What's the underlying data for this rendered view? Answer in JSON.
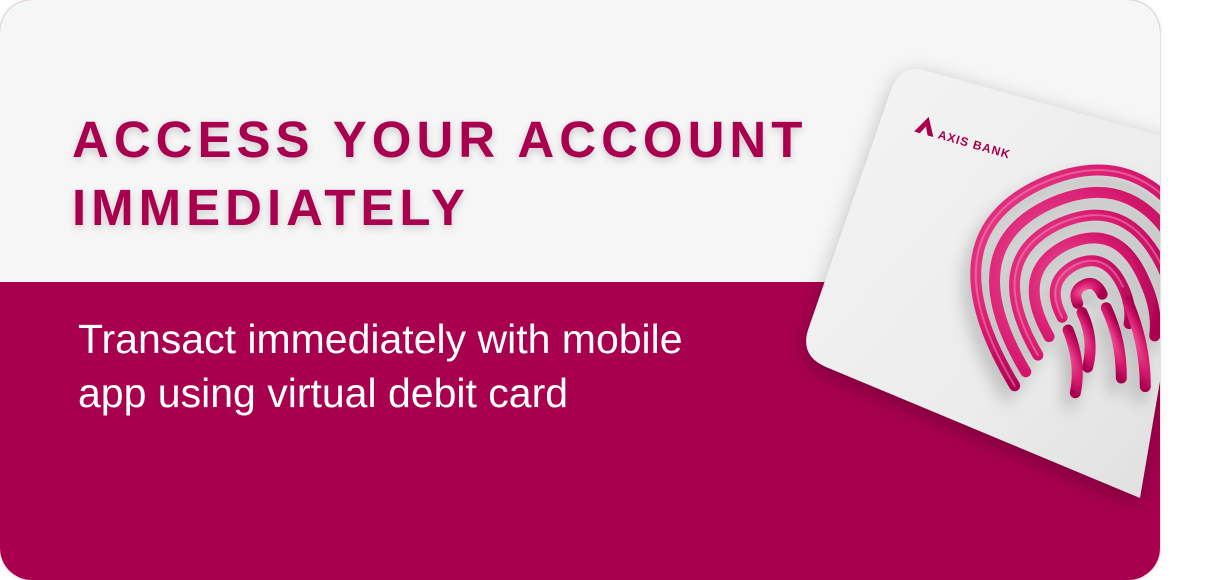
{
  "banner": {
    "headline_line1": "ACCESS YOUR ACCOUNT",
    "headline_line2": "IMMEDIATELY",
    "subtext_line1": "Transact immediately with mobile",
    "subtext_line2": "app using virtual debit card"
  },
  "card": {
    "brand": "AXIS BANK",
    "logo_icon": "axis-bank-logo-icon",
    "fingerprint_icon": "fingerprint-icon"
  },
  "colors": {
    "brand_maroon": "#a8004e",
    "top_background": "#f6f6f7",
    "fingerprint_pink": "#d81b6f",
    "card_white": "#efefef"
  }
}
